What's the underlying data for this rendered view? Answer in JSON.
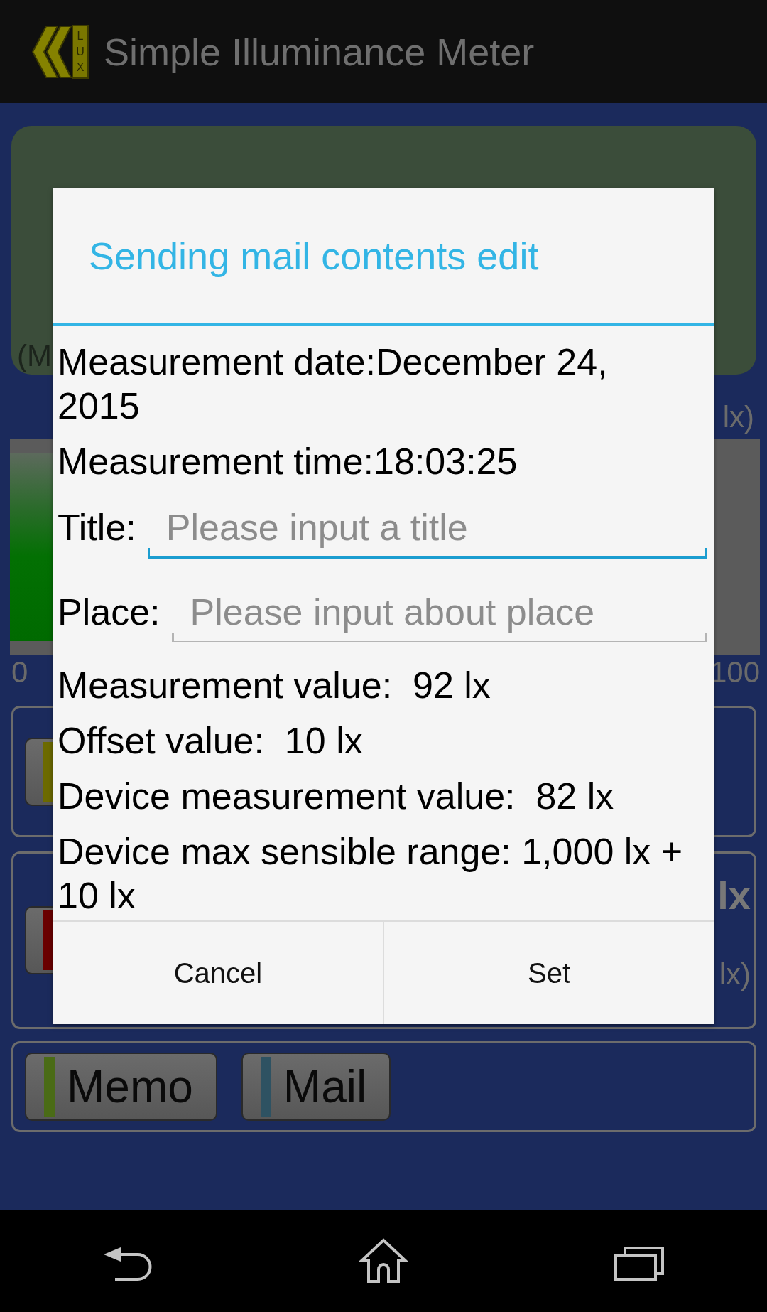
{
  "action_bar": {
    "logo_text": "LUX",
    "title": "Simple Illuminance Meter"
  },
  "meter": {
    "unit_note": "(M",
    "range_label": "lx)",
    "level": 0.92,
    "scale_min": "0",
    "scale_max": "100"
  },
  "panels": [
    {
      "buttons": [
        {
          "color": "#6c6a00"
        }
      ]
    },
    {
      "buttons": [
        {
          "color": "#6a0000"
        }
      ],
      "value_unit": "lx",
      "range_label": "lx)"
    },
    {
      "buttons": [
        {
          "label": "Memo",
          "color": "#4a6b16"
        },
        {
          "label": "Mail",
          "color": "#2e5262"
        }
      ]
    }
  ],
  "dialog": {
    "title": "Sending mail contents edit",
    "items": [
      {
        "kind": "text",
        "text": "Measurement date:December 24, 2015"
      },
      {
        "kind": "text",
        "text": "Measurement time:18:03:25"
      },
      {
        "kind": "field",
        "label": "Title:",
        "placeholder": "Please input a title",
        "focused": true
      },
      {
        "kind": "field",
        "label": "Place:",
        "placeholder": "Please input about place",
        "focused": false
      },
      {
        "kind": "text",
        "text": "Measurement value:  92 lx"
      },
      {
        "kind": "text",
        "text": "Offset value:  10 lx"
      },
      {
        "kind": "text",
        "text": "Device measurement value:  82 lx"
      },
      {
        "kind": "text",
        "text": "Device max sensible range: 1,000 lx + 10 lx"
      }
    ],
    "buttons": [
      "Cancel",
      "Set"
    ]
  }
}
